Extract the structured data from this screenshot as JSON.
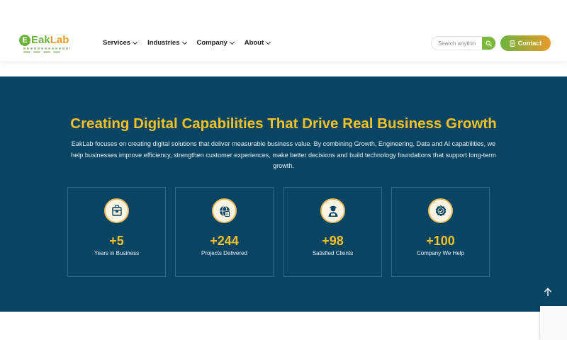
{
  "brand": {
    "name_part1": "Eak",
    "name_part2": "Lab",
    "mark": "E"
  },
  "nav": {
    "items": [
      {
        "label": "Services"
      },
      {
        "label": "Industries"
      },
      {
        "label": "Company"
      },
      {
        "label": "About"
      }
    ]
  },
  "search": {
    "placeholder": "Search anythin",
    "icon": "search-icon"
  },
  "contact": {
    "label": "Contact",
    "icon": "document-icon"
  },
  "hero": {
    "title": "Creating Digital Capabilities That Drive Real Business Growth",
    "description": "EakLab focuses on creating digital solutions that deliver measurable business value. By combining Growth, Engineering, Data and AI capabilities, we help businesses improve efficiency, strengthen customer experiences, make better decisions and build technology foundations that support long-term growth."
  },
  "stats": [
    {
      "value": "+5",
      "label": "Years in Business",
      "icon": "package-icon"
    },
    {
      "value": "+244",
      "label": "Projects Delivered",
      "icon": "globe-document-icon"
    },
    {
      "value": "+98",
      "label": "Satisfied Clients",
      "icon": "client-icon"
    },
    {
      "value": "+100",
      "label": "Company We Help",
      "icon": "badge-check-icon"
    }
  ],
  "colors": {
    "hero_bg": "#0a4463",
    "accent_yellow": "#f4c124",
    "brand_green": "#6cb33e",
    "brand_orange": "#e89a2a"
  }
}
